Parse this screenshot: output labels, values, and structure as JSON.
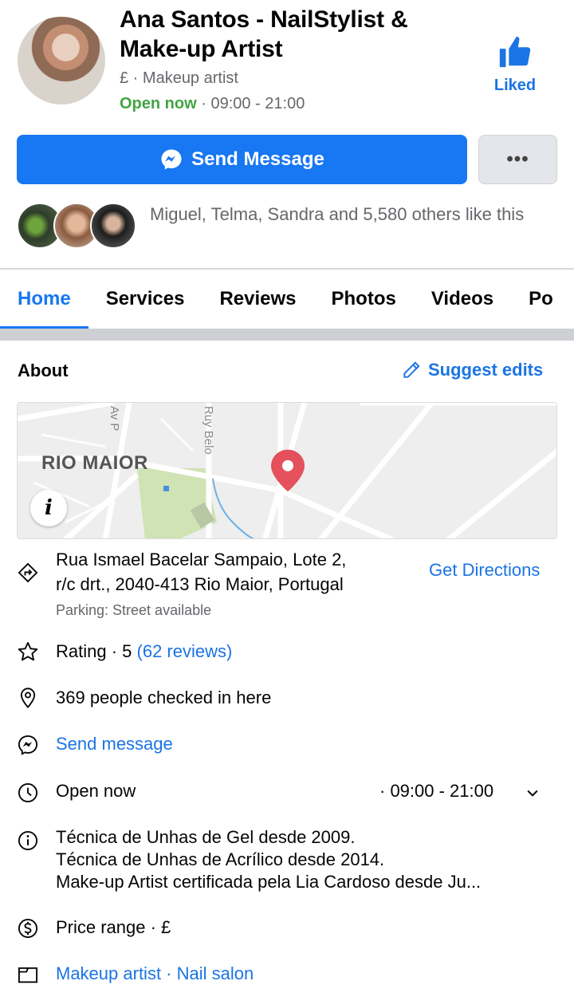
{
  "header": {
    "page_name": "Ana Santos - NailStylist & Make-up Artist",
    "price_level": "£",
    "category": "Makeup artist",
    "open_status": "Open now",
    "hours": "09:00 - 21:00",
    "liked_label": "Liked"
  },
  "actions": {
    "send_message": "Send Message",
    "more": "•••"
  },
  "likes": {
    "text": "Miguel, Telma, Sandra and 5,580 others like this"
  },
  "tabs": [
    "Home",
    "Services",
    "Reviews",
    "Photos",
    "Videos",
    "Po"
  ],
  "about": {
    "title": "About",
    "suggest_edits": "Suggest edits",
    "map": {
      "place_label": "RIO MAIOR",
      "street_1": "Av P",
      "street_2": "Ruy Belo"
    },
    "address_line1": "Rua Ismael Bacelar Sampaio, Lote 2,",
    "address_line2": "r/c drt., 2040-413 Rio Maior, Portugal",
    "parking": "Parking: Street available",
    "get_directions": "Get Directions",
    "rating_label": "Rating · 5",
    "rating_reviews": "(62 reviews)",
    "checkins": "369 people checked in here",
    "send_message": "Send message",
    "open_now": "Open now",
    "hours": "· 09:00 - 21:00",
    "bio_line1": "Técnica de Unhas de Gel desde 2009.",
    "bio_line2": "Técnica de Unhas de Acrílico desde 2014.",
    "bio_line3": "Make-up Artist certificada pela Lia Cardoso desde Ju...",
    "price_range": "Price range · £",
    "categories": "Makeup artist · Nail salon"
  },
  "colors": {
    "accent": "#1877f2",
    "link": "#1b74e4",
    "open_green": "#42a542",
    "map_pin": "#e4505b"
  }
}
